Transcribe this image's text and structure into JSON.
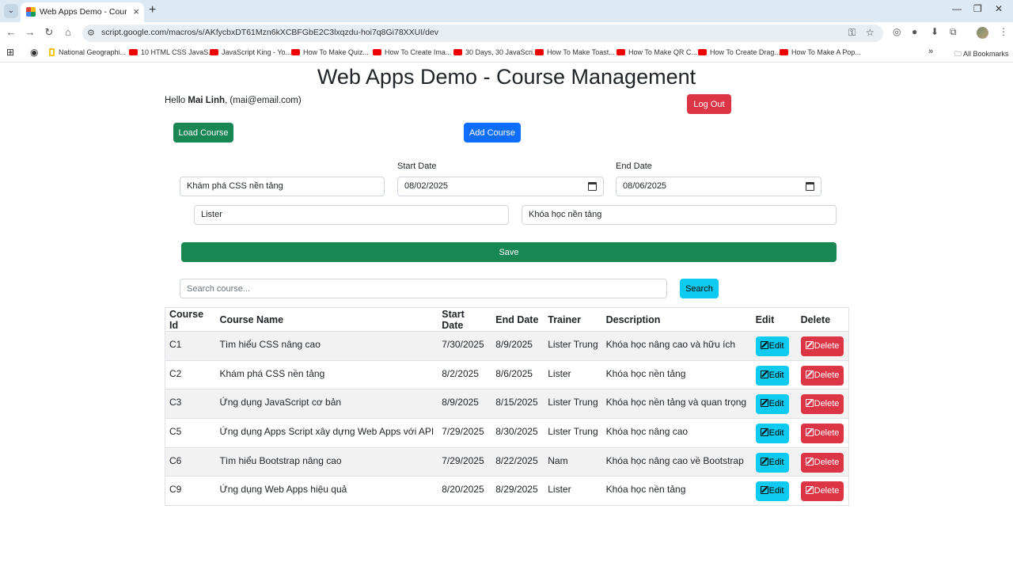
{
  "browser": {
    "tab_title": "Web Apps Demo - Course Man",
    "url": "script.google.com/macros/s/AKfycbxDT61Mzn6kXCBFGbE2C3lxqzdu-hoi7q8Gi78XXUI/dev",
    "bookmarks": [
      {
        "label": "National Geographi...",
        "icon": "ng-icon"
      },
      {
        "label": "10 HTML CSS JavaS...",
        "icon": "youtube-icon"
      },
      {
        "label": "JavaScript King - Yo...",
        "icon": "youtube-icon"
      },
      {
        "label": "How To Make Quiz...",
        "icon": "youtube-icon"
      },
      {
        "label": "How To Create Ima...",
        "icon": "youtube-icon"
      },
      {
        "label": "30 Days, 30 JavaScri...",
        "icon": "youtube-icon"
      },
      {
        "label": "How To Make Toast...",
        "icon": "youtube-icon"
      },
      {
        "label": "How To Make QR C...",
        "icon": "youtube-icon"
      },
      {
        "label": "How To Create Drag...",
        "icon": "youtube-icon"
      },
      {
        "label": "How To Make A Pop...",
        "icon": "youtube-icon"
      }
    ],
    "all_bookmarks": "All Bookmarks"
  },
  "page": {
    "title": "Web Apps Demo - Course Management",
    "greeting_prefix": "Hello ",
    "user_name": "Mai Linh",
    "user_email": ", (mai@email.com)",
    "logout_label": "Log Out",
    "load_course_label": "Load Course",
    "add_course_label": "Add Course"
  },
  "form": {
    "course_name": "Khám phá CSS nền tảng",
    "start_date_label": "Start Date",
    "start_date": "08/02/2025",
    "end_date_label": "End Date",
    "end_date": "08/06/2025",
    "trainer": "Lister",
    "description": "Khóa học nền tảng",
    "save_label": "Save"
  },
  "search": {
    "placeholder": "Search course...",
    "button_label": "Search"
  },
  "table": {
    "headers": [
      "Course Id",
      "Course Name",
      "Start Date",
      "End Date",
      "Trainer",
      "Description",
      "Edit",
      "Delete"
    ],
    "edit_label": "Edit",
    "delete_label": "Delete",
    "rows": [
      {
        "id": "C1",
        "name": "Tìm hiểu CSS nâng cao",
        "start": "7/30/2025",
        "end": "8/9/2025",
        "trainer": "Lister Trung",
        "desc": "Khóa học nâng cao và hữu ích"
      },
      {
        "id": "C2",
        "name": "Khám phá CSS nền tảng",
        "start": "8/2/2025",
        "end": "8/6/2025",
        "trainer": "Lister",
        "desc": "Khóa học nền tảng"
      },
      {
        "id": "C3",
        "name": "Ứng dụng JavaScript cơ bản",
        "start": "8/9/2025",
        "end": "8/15/2025",
        "trainer": "Lister Trung",
        "desc": "Khóa học nền tảng và quan trọng"
      },
      {
        "id": "C5",
        "name": "Ứng dụng Apps Script xây dựng Web Apps với API",
        "start": "7/29/2025",
        "end": "8/30/2025",
        "trainer": "Lister Trung",
        "desc": "Khóa học nâng cao"
      },
      {
        "id": "C6",
        "name": "Tìm hiểu Bootstrap nâng cao",
        "start": "7/29/2025",
        "end": "8/22/2025",
        "trainer": "Nam",
        "desc": "Khóa học nâng cao về Bootstrap"
      },
      {
        "id": "C9",
        "name": "Ứng dụng Web Apps hiệu quả",
        "start": "8/20/2025",
        "end": "8/29/2025",
        "trainer": "Lister",
        "desc": "Khóa học nền tảng"
      }
    ]
  },
  "colors": {
    "danger": "#dc3545",
    "success": "#198754",
    "primary": "#0d6efd",
    "info": "#0dcaf0"
  }
}
